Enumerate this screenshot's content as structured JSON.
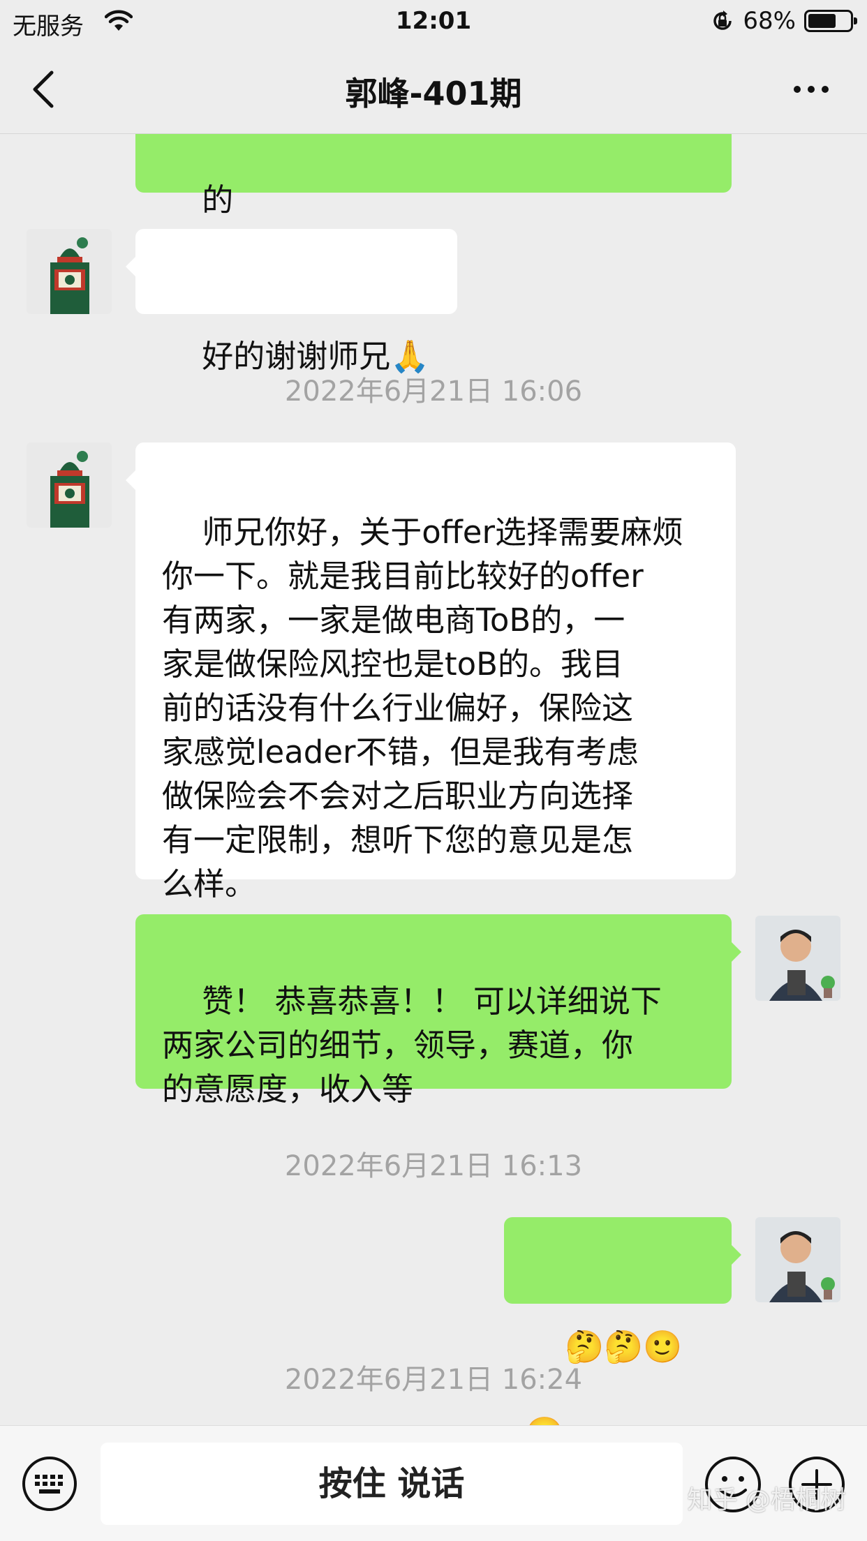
{
  "status_bar": {
    "carrier": "无服务",
    "time": "12:01",
    "battery_percent_text": "68%",
    "battery_level": 0.68
  },
  "nav": {
    "title": "郭峰-401期"
  },
  "messages": [
    {
      "side": "right",
      "text": "的"
    },
    {
      "side": "left",
      "text": "好的谢谢师兄🙏"
    },
    {
      "side": "left",
      "text": "师兄你好，关于offer选择需要麻烦\n你一下。就是我目前比较好的offer\n有两家，一家是做电商ToB的，一\n家是做保险风控也是toB的。我目\n前的话没有什么行业偏好，保险这\n家感觉leader不错，但是我有考虑\n做保险会不会对之后职业方向选择\n有一定限制，想听下您的意见是怎\n么样。"
    },
    {
      "side": "right",
      "text": "赞！ 恭喜恭喜！！ 可以详细说下\n两家公司的细节，领导，赛道，你\n的意愿度，收入等"
    },
    {
      "side": "right",
      "text": "🤔🤔🙂🙂"
    }
  ],
  "timestamps": [
    "2022年6月21日 16:06",
    "2022年6月21日 16:13",
    "2022年6月21日 16:24"
  ],
  "input_bar": {
    "hold_to_talk": "按住 说话"
  },
  "watermark": "知乎 @梧桐树",
  "colors": {
    "background": "#ededed",
    "sent_bubble": "#95ec69",
    "received_bubble": "#ffffff"
  }
}
